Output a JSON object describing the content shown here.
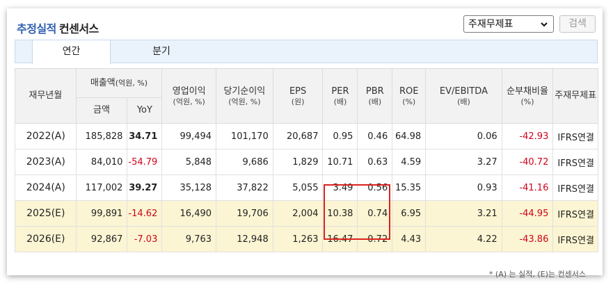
{
  "header": {
    "title_blue": "추정실적",
    "title_dark": "컨센서스",
    "select_value": "주재무제표",
    "search_label": "검색"
  },
  "tabs": [
    "연간",
    "분기"
  ],
  "columns": {
    "period": "재무년월",
    "sales": "매출액",
    "sales_unit": "(억원, %)",
    "sales_amount": "금액",
    "sales_yoy": "YoY",
    "op": "영업이익",
    "op_unit": "(억원, %)",
    "net": "당기순이익",
    "net_unit": "(억원, %)",
    "eps": "EPS",
    "eps_unit": "(원)",
    "per": "PER",
    "per_unit": "(배)",
    "pbr": "PBR",
    "pbr_unit": "(배)",
    "roe": "ROE",
    "roe_unit": "(%)",
    "ev": "EV/EBITDA",
    "ev_unit": "(배)",
    "debt": "순부채비율",
    "debt_unit": "(%)",
    "fs": "주재무제표"
  },
  "rows": [
    {
      "period": "2022(A)",
      "sales": "185,828",
      "yoy": "34.71",
      "op": "99,494",
      "net": "101,170",
      "eps": "20,687",
      "per": "0.95",
      "pbr": "0.46",
      "roe": "64.98",
      "ev": "0.06",
      "debt": "-42.93",
      "fs": "IFRS연결"
    },
    {
      "period": "2023(A)",
      "sales": "84,010",
      "yoy": "-54.79",
      "op": "5,848",
      "net": "9,686",
      "eps": "1,829",
      "per": "10.71",
      "pbr": "0.63",
      "roe": "4.59",
      "ev": "3.27",
      "debt": "-40.72",
      "fs": "IFRS연결"
    },
    {
      "period": "2024(A)",
      "sales": "117,002",
      "yoy": "39.27",
      "op": "35,128",
      "net": "37,822",
      "eps": "5,055",
      "per": "3.49",
      "pbr": "0.56",
      "roe": "15.35",
      "ev": "0.93",
      "debt": "-41.16",
      "fs": "IFRS연결"
    },
    {
      "period": "2025(E)",
      "sales": "99,891",
      "yoy": "-14.62",
      "op": "16,490",
      "net": "19,706",
      "eps": "2,004",
      "per": "10.38",
      "pbr": "0.74",
      "roe": "6.95",
      "ev": "3.21",
      "debt": "-44.95",
      "fs": "IFRS연결"
    },
    {
      "period": "2026(E)",
      "sales": "92,867",
      "yoy": "-7.03",
      "op": "9,763",
      "net": "12,948",
      "eps": "1,263",
      "per": "16.47",
      "pbr": "0.72",
      "roe": "4.43",
      "ev": "4.22",
      "debt": "-43.86",
      "fs": "IFRS연결"
    }
  ],
  "footnote": "* (A) 는 실적, (E)는 컨센서스",
  "colors": {
    "accent": "#2f5fae",
    "negative": "#d0021b",
    "estimate_bg": "#fbf5d3",
    "highlight_box": "#d9231f"
  }
}
